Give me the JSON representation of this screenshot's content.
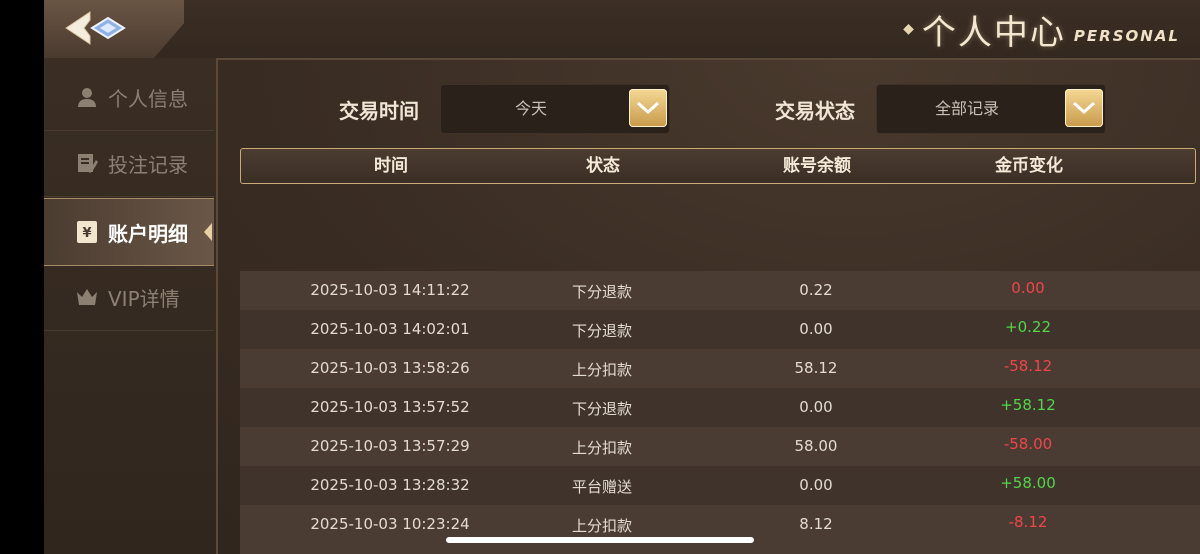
{
  "header": {
    "title_cn": "个人中心",
    "title_en": "PERSONAL",
    "back_icon": "back-arrow-icon"
  },
  "sidebar": {
    "items": [
      {
        "label": "个人信息",
        "icon": "user-icon",
        "active": false
      },
      {
        "label": "投注记录",
        "icon": "note-edit-icon",
        "active": false
      },
      {
        "label": "账户明细",
        "icon": "yuan-ledger-icon",
        "active": true
      },
      {
        "label": "VIP详情",
        "icon": "crown-icon",
        "active": false
      }
    ]
  },
  "filters": {
    "time_label": "交易时间",
    "time_value": "今天",
    "status_label": "交易状态",
    "status_value": "全部记录"
  },
  "table": {
    "columns": [
      "时间",
      "状态",
      "账号余额",
      "金币变化"
    ],
    "rows": [
      {
        "time": "2025-10-03 14:11:22",
        "status": "下分退款",
        "balance": "0.22",
        "change": "0.00",
        "change_type": "neg"
      },
      {
        "time": "2025-10-03 14:02:01",
        "status": "下分退款",
        "balance": "0.00",
        "change": "+0.22",
        "change_type": "pos"
      },
      {
        "time": "2025-10-03 13:58:26",
        "status": "上分扣款",
        "balance": "58.12",
        "change": "-58.12",
        "change_type": "neg"
      },
      {
        "time": "2025-10-03 13:57:52",
        "status": "下分退款",
        "balance": "0.00",
        "change": "+58.12",
        "change_type": "pos"
      },
      {
        "time": "2025-10-03 13:57:29",
        "status": "上分扣款",
        "balance": "58.00",
        "change": "-58.00",
        "change_type": "neg"
      },
      {
        "time": "2025-10-03 13:28:32",
        "status": "平台赠送",
        "balance": "0.00",
        "change": "+58.00",
        "change_type": "pos"
      },
      {
        "time": "2025-10-03 10:23:24",
        "status": "上分扣款",
        "balance": "8.12",
        "change": "-8.12",
        "change_type": "neg"
      }
    ]
  },
  "colors": {
    "positive": "#52d64a",
    "negative": "#f0454a",
    "accent_gold": "#e8c27a"
  }
}
